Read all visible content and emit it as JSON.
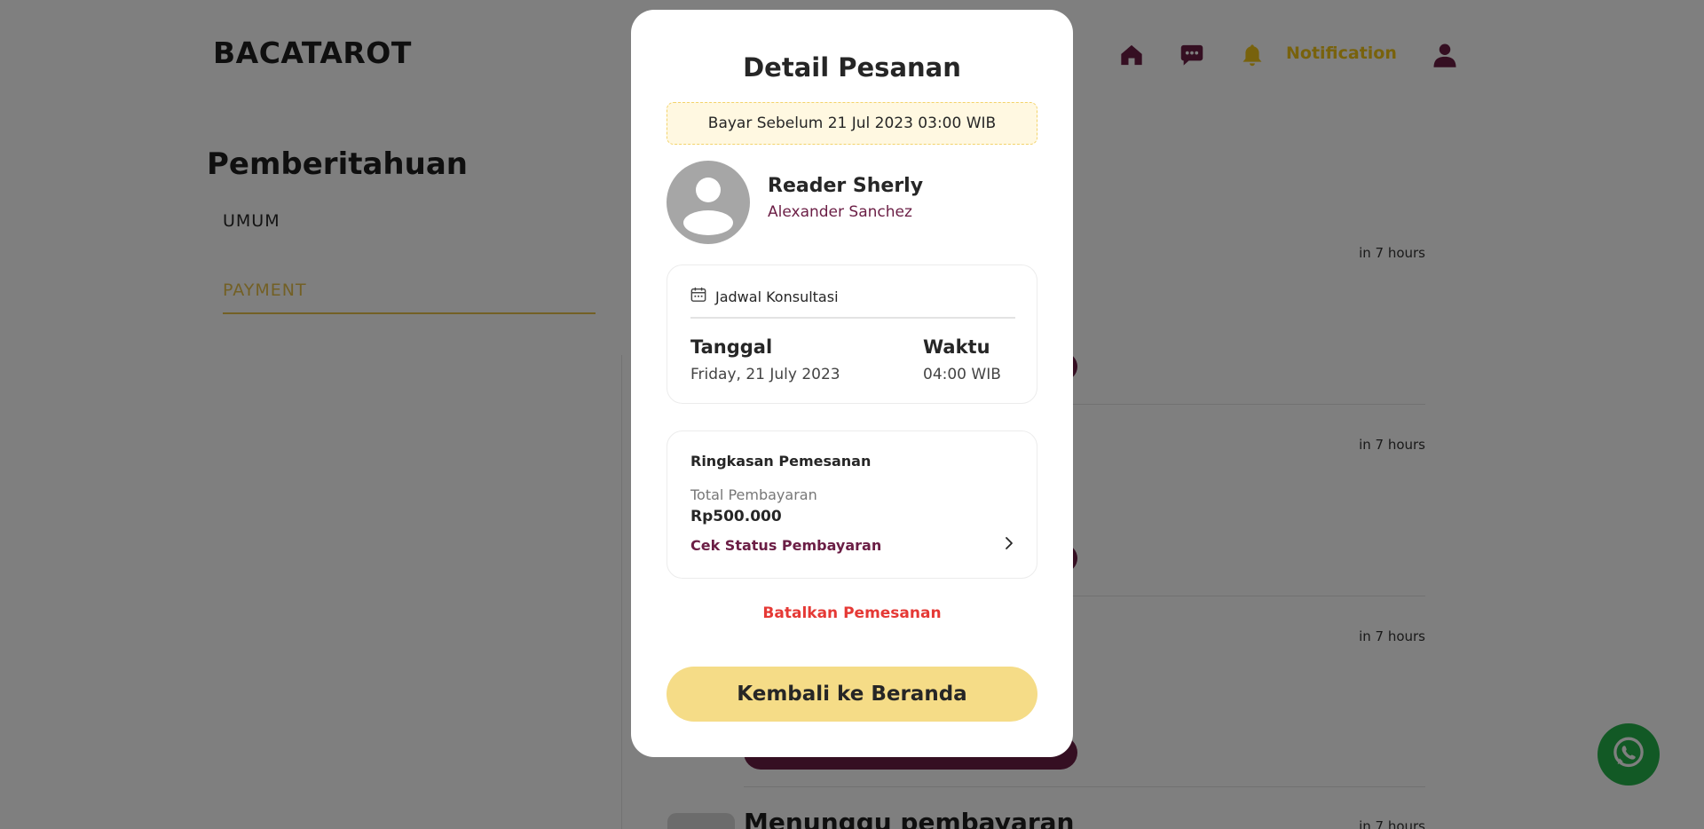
{
  "app": {
    "logo": "BACATAROT"
  },
  "nav": {
    "notification_label": "Notification"
  },
  "page": {
    "title": "Pemberitahuan",
    "tabs": [
      "UMUM",
      "PAYMENT"
    ],
    "active_tab": "PAYMENT",
    "notifications": [
      {
        "time": "in 7 hours"
      },
      {
        "time": "in 7 hours"
      },
      {
        "time": "in 7 hours"
      },
      {
        "time": "in 7 hours",
        "title": "Menunggu pembayaran"
      }
    ]
  },
  "modal": {
    "title": "Detail Pesanan",
    "deadline": "Bayar Sebelum 21 Jul 2023 03:00 WIB",
    "reader": {
      "name": "Reader Sherly",
      "client": "Alexander Sanchez"
    },
    "schedule": {
      "heading": "Jadwal Konsultasi",
      "date_label": "Tanggal",
      "date_value": "Friday, 21 July 2023",
      "time_label": "Waktu",
      "time_value": "04:00 WIB"
    },
    "summary": {
      "heading": "Ringkasan Pemesanan",
      "total_label": "Total Pembayaran",
      "total_value": "Rp500.000",
      "status_link": "Cek Status Pembayaran"
    },
    "cancel_label": "Batalkan Pemesanan",
    "home_button": "Kembali ke Beranda"
  },
  "colors": {
    "brand": "#6b1e45",
    "accent": "#f0c419",
    "button_yellow": "#f5dc87",
    "danger": "#e53935",
    "whatsapp": "#25b24a"
  },
  "icons": [
    "home-icon",
    "chat-icon",
    "bell-icon",
    "profile-icon",
    "calendar-icon",
    "chevron-right-icon",
    "whatsapp-icon"
  ]
}
